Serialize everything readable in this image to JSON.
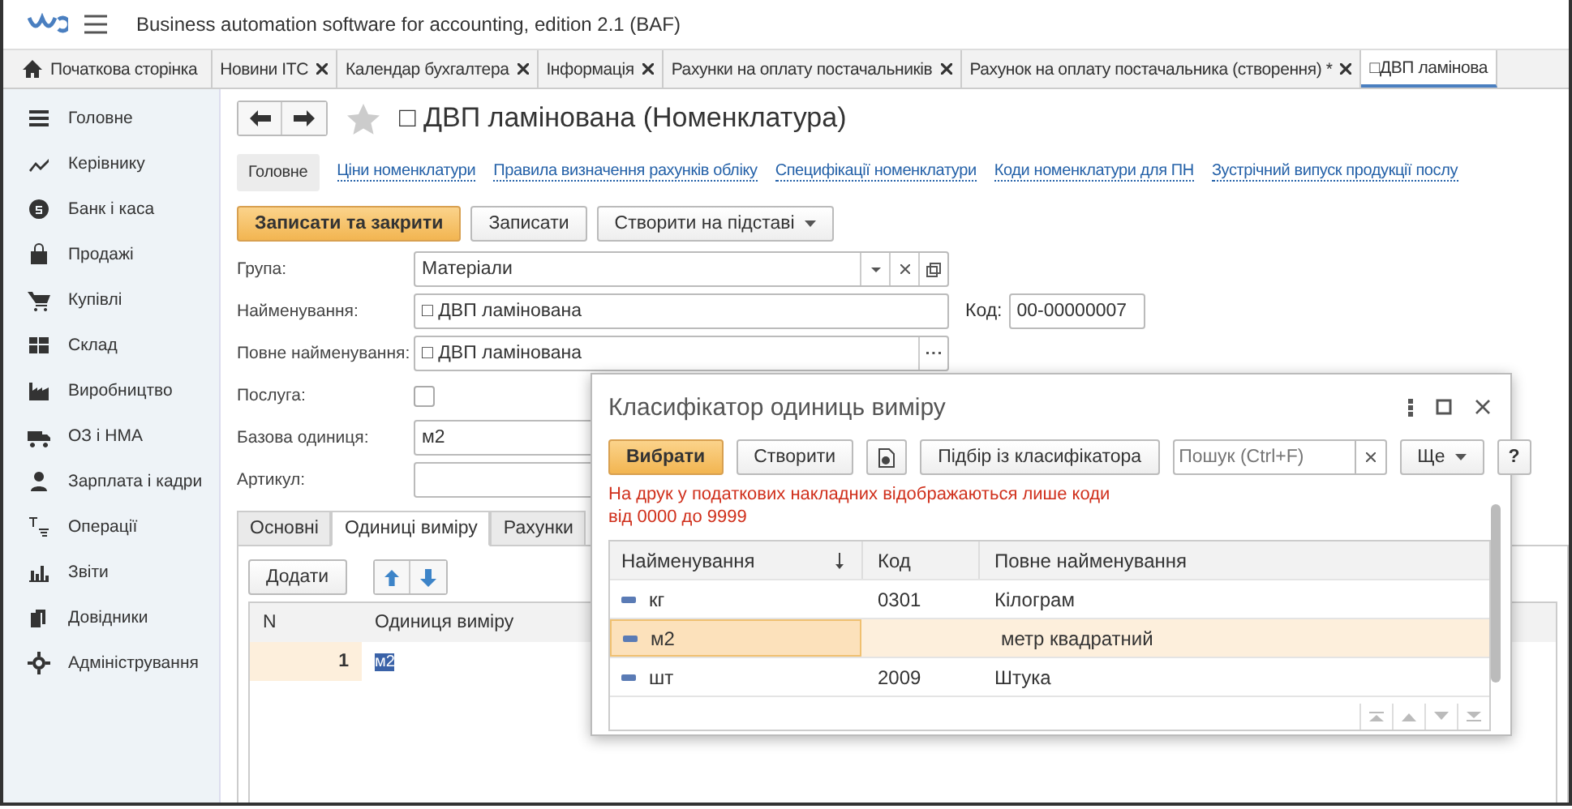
{
  "app_title": "Business automation software for accounting, edition 2.1  (BAF)",
  "tabs": [
    {
      "label": "Початкова сторінка",
      "kind": "home",
      "selected": false
    },
    {
      "label": "Новини ІТС",
      "kind": "closable",
      "selected": false
    },
    {
      "label": "Календар бухгалтера",
      "kind": "closable",
      "selected": false
    },
    {
      "label": "Інформація",
      "kind": "closable",
      "selected": false
    },
    {
      "label": "Рахунки на оплату постачальників",
      "kind": "closable",
      "selected": false
    },
    {
      "label": "Рахунок на оплату постачальника (створення) *",
      "kind": "closable",
      "selected": false
    },
    {
      "label": "□ДВП ламінова",
      "kind": "closable",
      "selected": true
    }
  ],
  "sidebar": {
    "items": [
      {
        "label": "Головне"
      },
      {
        "label": "Керівнику"
      },
      {
        "label": "Банк і каса"
      },
      {
        "label": "Продажі"
      },
      {
        "label": "Купівлі"
      },
      {
        "label": "Склад"
      },
      {
        "label": "Виробництво"
      },
      {
        "label": "ОЗ і НМА"
      },
      {
        "label": "Зарплата і кадри"
      },
      {
        "label": "Операції"
      },
      {
        "label": "Звіти"
      },
      {
        "label": "Довідники"
      },
      {
        "label": "Адміністрування"
      }
    ]
  },
  "form": {
    "title": "□ ДВП ламінована (Номенклатура)",
    "nav": [
      {
        "label": "Головне",
        "selected": true
      },
      {
        "label": "Ціни номенклатури",
        "selected": false
      },
      {
        "label": "Правила визначення рахунків обліку",
        "selected": false
      },
      {
        "label": "Специфікації номенклатури",
        "selected": false
      },
      {
        "label": "Коди номенклатури для ПН",
        "selected": false
      },
      {
        "label": "Зустрічний випуск продукції послу",
        "selected": false
      }
    ],
    "buttons": {
      "save_close": "Записати та закрити",
      "save": "Записати",
      "create_based": "Створити на підставі"
    },
    "group_label": "Група:",
    "group": "Матеріали",
    "name_label": "Найменування:",
    "name": "□ ДВП ламінована",
    "code_label": "Код:",
    "code": "00-00000007",
    "full_name_label": "Повне найменування:",
    "full_name": "□ ДВП ламінована",
    "service_label": "Послуга:",
    "service_checked": false,
    "base_unit_label": "Базова одиниця:",
    "base_unit": "м2",
    "article_label": "Артикул:",
    "tabs": [
      {
        "label": "Основні",
        "selected": false
      },
      {
        "label": "Одиниці виміру",
        "selected": true
      },
      {
        "label": "Рахунки",
        "selected": false
      }
    ],
    "add_button": "Додати",
    "table": {
      "columns": [
        "N",
        "Одиниця виміру"
      ],
      "rows": [
        {
          "n": "1",
          "unit": "м2"
        }
      ]
    }
  },
  "dialog": {
    "title": "Класифікатор одиниць виміру",
    "buttons": {
      "choose": "Вибрати",
      "create": "Створити",
      "pick": "Підбір із класифікатора",
      "more": "Ще",
      "help": "?"
    },
    "search": {
      "placeholder": "Пошук (Ctrl+F)"
    },
    "note": "На друк у податкових накладних відображаються лише коди від 0000 до 9999",
    "columns": [
      "Найменування",
      "Код",
      "Повне найменування"
    ],
    "rows": [
      {
        "name": "кг",
        "code": "0301",
        "full_name": "Кілограм",
        "selected": false
      },
      {
        "name": "м2",
        "code": "",
        "full_name": "метр квадратний",
        "selected": true
      },
      {
        "name": "шт",
        "code": "2009",
        "full_name": "Штука",
        "selected": false
      }
    ]
  }
}
